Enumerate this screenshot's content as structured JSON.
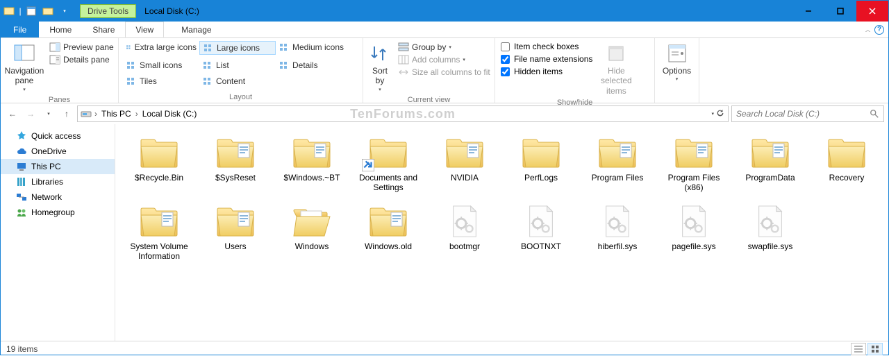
{
  "titlebar": {
    "caption": "Local Disk (C:)",
    "context_tab": "Drive Tools"
  },
  "ribbon": {
    "file": "File",
    "tabs": [
      "Home",
      "Share",
      "View",
      "Manage"
    ],
    "active_tab": "View",
    "groups": {
      "panes": {
        "label": "Panes",
        "nav_pane": "Navigation\npane",
        "preview": "Preview pane",
        "details": "Details pane"
      },
      "layout": {
        "label": "Layout",
        "items": [
          "Extra large icons",
          "Large icons",
          "Medium icons",
          "Small icons",
          "List",
          "Details",
          "Tiles",
          "Content"
        ],
        "selected": "Large icons"
      },
      "current_view": {
        "label": "Current view",
        "sort_by": "Sort\nby",
        "group_by": "Group by",
        "add_cols": "Add columns",
        "size_cols": "Size all columns to fit"
      },
      "show_hide": {
        "label": "Show/hide",
        "item_check": "Item check boxes",
        "file_ext": "File name extensions",
        "hidden": "Hidden items",
        "hide_sel": "Hide selected\nitems",
        "item_check_val": false,
        "file_ext_val": true,
        "hidden_val": true
      },
      "options": "Options"
    }
  },
  "breadcrumbs": [
    "This PC",
    "Local Disk (C:)"
  ],
  "search_placeholder": "Search Local Disk (C:)",
  "sidebar": {
    "items": [
      {
        "label": "Quick access",
        "icon": "star",
        "color": "#33a6de"
      },
      {
        "label": "OneDrive",
        "icon": "cloud",
        "color": "#2b7cd3"
      },
      {
        "label": "This PC",
        "icon": "pc",
        "color": "#2b7cd3",
        "selected": true
      },
      {
        "label": "Libraries",
        "icon": "lib",
        "color": "#36a2c9"
      },
      {
        "label": "Network",
        "icon": "net",
        "color": "#2b7cd3"
      },
      {
        "label": "Homegroup",
        "icon": "home",
        "color": "#4aa64a"
      }
    ]
  },
  "items": [
    {
      "name": "$Recycle.Bin",
      "type": "folder"
    },
    {
      "name": "$SysReset",
      "type": "folder-docs"
    },
    {
      "name": "$Windows.~BT",
      "type": "folder-docs"
    },
    {
      "name": "Documents and Settings",
      "type": "folder",
      "shortcut": true
    },
    {
      "name": "NVIDIA",
      "type": "folder-docs"
    },
    {
      "name": "PerfLogs",
      "type": "folder"
    },
    {
      "name": "Program Files",
      "type": "folder-docs"
    },
    {
      "name": "Program Files (x86)",
      "type": "folder-docs"
    },
    {
      "name": "ProgramData",
      "type": "folder-docs"
    },
    {
      "name": "Recovery",
      "type": "folder"
    },
    {
      "name": "System Volume Information",
      "type": "folder-docs"
    },
    {
      "name": "Users",
      "type": "folder-docs"
    },
    {
      "name": "Windows",
      "type": "folder-open"
    },
    {
      "name": "Windows.old",
      "type": "folder-docs"
    },
    {
      "name": "bootmgr",
      "type": "sysfile"
    },
    {
      "name": "BOOTNXT",
      "type": "sysfile"
    },
    {
      "name": "hiberfil.sys",
      "type": "sysfile"
    },
    {
      "name": "pagefile.sys",
      "type": "sysfile"
    },
    {
      "name": "swapfile.sys",
      "type": "sysfile"
    }
  ],
  "status": {
    "count": "19 items"
  },
  "watermark": "TenForums.com"
}
